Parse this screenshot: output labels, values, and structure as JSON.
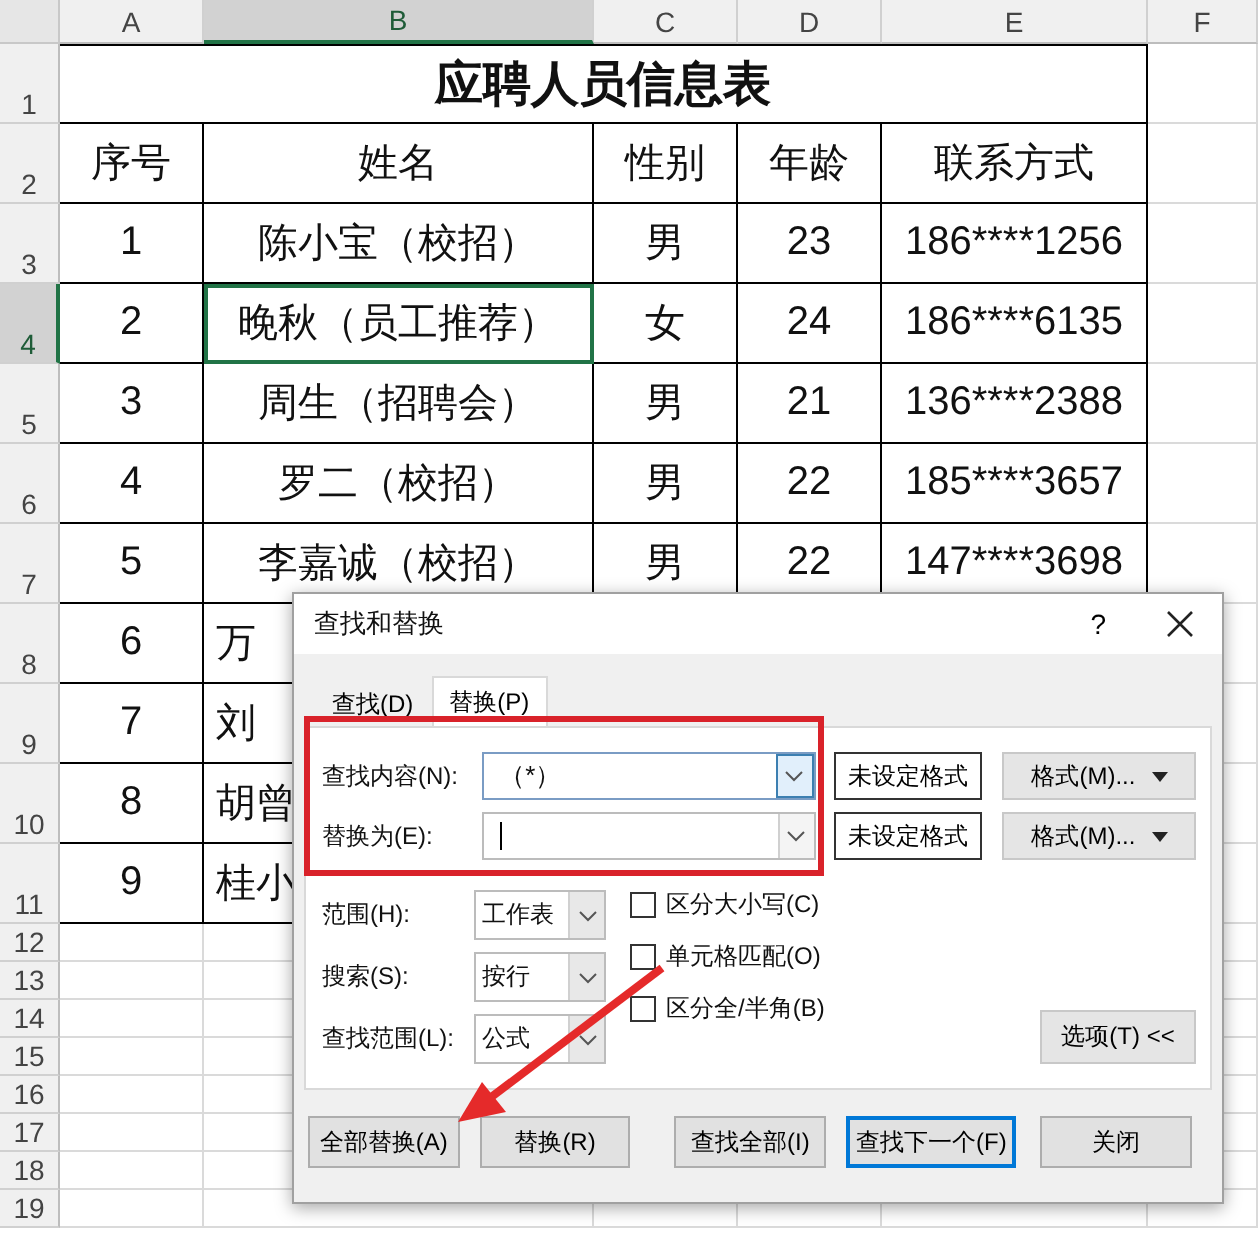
{
  "sheet": {
    "title": "应聘人员信息表",
    "columns": [
      {
        "label": "A",
        "selected": false
      },
      {
        "label": "B",
        "selected": true
      },
      {
        "label": "C",
        "selected": false
      },
      {
        "label": "D",
        "selected": false
      },
      {
        "label": "E",
        "selected": false
      },
      {
        "label": "F",
        "selected": false
      }
    ],
    "rows": [
      {
        "number": "1",
        "selected": false,
        "kind": "title",
        "cells": []
      },
      {
        "number": "2",
        "selected": false,
        "kind": "data",
        "cells": [
          "序号",
          "姓名",
          "性别",
          "年龄",
          "联系方式"
        ]
      },
      {
        "number": "3",
        "selected": false,
        "kind": "data",
        "cells": [
          "1",
          "陈小宝（校招）",
          "男",
          "23",
          "186****1256"
        ]
      },
      {
        "number": "4",
        "selected": true,
        "kind": "data",
        "cells": [
          "2",
          "晚秋（员工推荐）",
          "女",
          "24",
          "186****6135"
        ]
      },
      {
        "number": "5",
        "selected": false,
        "kind": "data",
        "cells": [
          "3",
          "周生（招聘会）",
          "男",
          "21",
          "136****2388"
        ]
      },
      {
        "number": "6",
        "selected": false,
        "kind": "data",
        "cells": [
          "4",
          "罗二（校招）",
          "男",
          "22",
          "185****3657"
        ]
      },
      {
        "number": "7",
        "selected": false,
        "kind": "data",
        "cells": [
          "5",
          "李嘉诚（校招）",
          "男",
          "22",
          "147****3698"
        ]
      },
      {
        "number": "8",
        "selected": false,
        "kind": "data",
        "cells": [
          "6",
          "万"
        ]
      },
      {
        "number": "9",
        "selected": false,
        "kind": "data",
        "cells": [
          "7",
          "刘"
        ]
      },
      {
        "number": "10",
        "selected": false,
        "kind": "data",
        "cells": [
          "8",
          "胡曾"
        ]
      },
      {
        "number": "11",
        "selected": false,
        "kind": "data",
        "cells": [
          "9",
          "桂小"
        ]
      },
      {
        "number": "12",
        "selected": false,
        "kind": "blank",
        "cells": []
      },
      {
        "number": "13",
        "selected": false,
        "kind": "blank",
        "cells": []
      },
      {
        "number": "14",
        "selected": false,
        "kind": "blank",
        "cells": []
      },
      {
        "number": "15",
        "selected": false,
        "kind": "blank",
        "cells": []
      },
      {
        "number": "16",
        "selected": false,
        "kind": "blank",
        "cells": []
      },
      {
        "number": "17",
        "selected": false,
        "kind": "blank",
        "cells": []
      },
      {
        "number": "18",
        "selected": false,
        "kind": "blank",
        "cells": []
      },
      {
        "number": "19",
        "selected": false,
        "kind": "blank",
        "cells": []
      }
    ]
  },
  "dialog": {
    "title": "查找和替换",
    "help": "?",
    "tabs": [
      {
        "label": "查找(D)",
        "selected": false
      },
      {
        "label": "替换(P)",
        "selected": true
      }
    ],
    "fields": [
      {
        "label": "查找内容(N):",
        "value": "（*）",
        "focused": true,
        "cursor": false,
        "format_status": "未设定格式",
        "format_button": "格式(M)..."
      },
      {
        "label": "替换为(E):",
        "focused": false,
        "cursor": true,
        "format_status": "未设定格式",
        "format_button": "格式(M)..."
      }
    ],
    "options": [
      {
        "label": "范围(H):",
        "value": "工作表"
      },
      {
        "label": "搜索(S):",
        "value": "按行"
      },
      {
        "label": "查找范围(L):",
        "value": "公式"
      }
    ],
    "checkboxes": [
      {
        "label": "区分大小写(C)",
        "checked": false
      },
      {
        "label": "单元格匹配(O)",
        "checked": false
      },
      {
        "label": "区分全/半角(B)",
        "checked": false
      }
    ],
    "options_button": "选项(T) <<",
    "buttons": [
      {
        "label": "全部替换(A)",
        "default": false
      },
      {
        "label": "替换(R)",
        "default": false
      },
      {
        "label": "查找全部(I)",
        "default": false
      },
      {
        "label": "查找下一个(F)",
        "default": true
      },
      {
        "label": "关闭",
        "default": false
      }
    ]
  }
}
